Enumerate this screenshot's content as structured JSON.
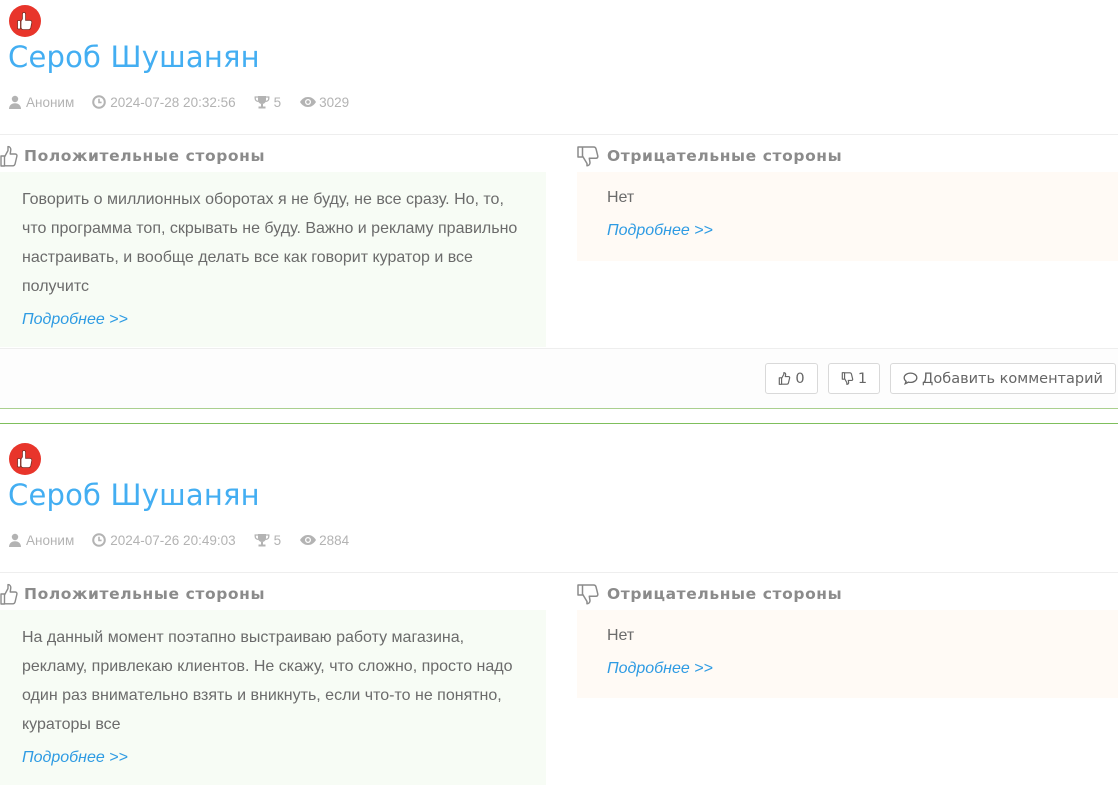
{
  "reviews": [
    {
      "author_title": "Сероб Шушанян",
      "user": "Аноним",
      "datetime": "2024-07-28 20:32:56",
      "rating": "5",
      "views": "3029",
      "positive_heading": "Положительные стороны",
      "positive_text": "Говорить о миллионных оборотах я не буду, не все сразу. Но, то, что программа топ, скрывать не буду. Важно и рекламу правильно настраивать, и вообще делать все как говорит куратор и все получитс",
      "positive_more": "Подробнее >>",
      "negative_heading": "Отрицательные стороны",
      "negative_text": "Нет",
      "negative_more": "Подробнее >>",
      "likes": "0",
      "dislikes": "1",
      "comment_label": "Добавить комментарий"
    },
    {
      "author_title": "Сероб Шушанян",
      "user": "Аноним",
      "datetime": "2024-07-26 20:49:03",
      "rating": "5",
      "views": "2884",
      "positive_heading": "Положительные стороны",
      "positive_text": "На данный момент поэтапно выстраиваю работу магазина, рекламу, привлекаю клиентов. Не скажу, что сложно, просто надо один раз внимательно взять и вникнуть, если что-то не понятно, кураторы все",
      "positive_more": "Подробнее >>",
      "negative_heading": "Отрицательные стороны",
      "negative_text": "Нет",
      "negative_more": "Подробнее >>"
    }
  ],
  "icons": {
    "badge": "thumb-up-badge-icon",
    "user": "user-icon",
    "clock": "clock-icon",
    "trophy": "trophy-icon",
    "eye": "eye-icon",
    "positive": "thumbs-up-outline-icon",
    "negative": "thumbs-down-outline-icon",
    "comment": "comment-icon"
  },
  "colors": {
    "title": "#43aef2",
    "badge": "#e8352b",
    "link": "#2e9be3",
    "positive_bg": "#f7fcf5",
    "negative_bg": "#fffaf5",
    "separator": "#7fbf5c"
  }
}
